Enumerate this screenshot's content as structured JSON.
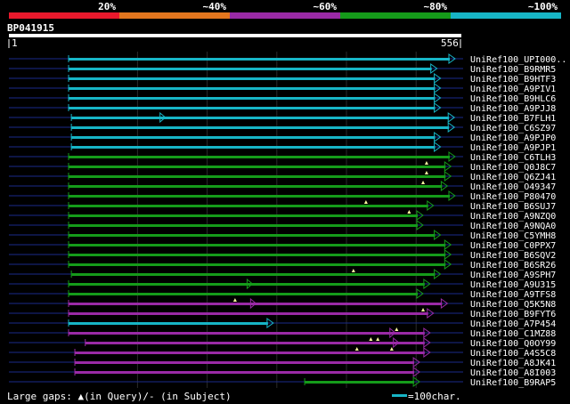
{
  "query_id": "BP041915",
  "length_start": "1",
  "length_end": "556",
  "identity_scale": [
    {
      "label": "20%",
      "color": "#e8192c"
    },
    {
      "label": "~40%",
      "color": "#e3761e"
    },
    {
      "label": "~60%",
      "color": "#9a2aa6"
    },
    {
      "label": "~80%",
      "color": "#159b1a"
    },
    {
      "label": "~100%",
      "color": "#17b5c6"
    }
  ],
  "footer": {
    "gaps_text": "Large gaps: ▲(in Query)/- (in Subject)",
    "scale_text": "=100char."
  },
  "chart_data": {
    "type": "alignment",
    "query_length": 556,
    "hits": [
      {
        "name": "UniRef100_UPI000..",
        "identity": "~100%",
        "start": 1,
        "end": 556,
        "markers": [],
        "sub_start": null
      },
      {
        "name": "UniRef100_B9RMR5",
        "identity": "~100%",
        "start": 1,
        "end": 530,
        "markers": [],
        "sub_start": null
      },
      {
        "name": "UniRef100_B9HTF3",
        "identity": "~100%",
        "start": 1,
        "end": 535,
        "markers": [],
        "sub_start": null
      },
      {
        "name": "UniRef100_A9PIV1",
        "identity": "~100%",
        "start": 1,
        "end": 535,
        "markers": [],
        "sub_start": null
      },
      {
        "name": "UniRef100_B9HLC6",
        "identity": "~100%",
        "start": 1,
        "end": 535,
        "markers": [],
        "sub_start": null
      },
      {
        "name": "UniRef100_A9PJJ8",
        "identity": "~100%",
        "start": 1,
        "end": 535,
        "markers": [],
        "sub_start": null
      },
      {
        "name": "UniRef100_B7FLH1",
        "identity": "~100%",
        "start": 5,
        "end": 555,
        "markers": [],
        "sub_start": 140
      },
      {
        "name": "UniRef100_C6SZ97",
        "identity": "~100%",
        "start": 5,
        "end": 555,
        "markers": [],
        "sub_start": null
      },
      {
        "name": "UniRef100_A9PJP0",
        "identity": "~100%",
        "start": 5,
        "end": 535,
        "markers": [],
        "sub_start": null
      },
      {
        "name": "UniRef100_A9PJP1",
        "identity": "~100%",
        "start": 5,
        "end": 535,
        "markers": [],
        "sub_start": null
      },
      {
        "name": "UniRef100_C6TLH3",
        "identity": "~80%",
        "start": 1,
        "end": 556,
        "markers": [],
        "sub_start": null
      },
      {
        "name": "UniRef100_Q0J8C7",
        "identity": "~80%",
        "start": 1,
        "end": 550,
        "markers": [
          515
        ],
        "sub_start": null
      },
      {
        "name": "UniRef100_Q6ZJ41",
        "identity": "~80%",
        "start": 1,
        "end": 550,
        "markers": [
          515
        ],
        "sub_start": null
      },
      {
        "name": "UniRef100_O49347",
        "identity": "~80%",
        "start": 1,
        "end": 545,
        "markers": [
          510
        ],
        "sub_start": null
      },
      {
        "name": "UniRef100_P80470",
        "identity": "~80%",
        "start": 1,
        "end": 556,
        "markers": [],
        "sub_start": null
      },
      {
        "name": "UniRef100_B6SUJ7",
        "identity": "~80%",
        "start": 1,
        "end": 525,
        "markers": [
          428
        ],
        "sub_start": null
      },
      {
        "name": "UniRef100_A9NZQ0",
        "identity": "~80%",
        "start": 1,
        "end": 510,
        "markers": [
          490
        ],
        "sub_start": null
      },
      {
        "name": "UniRef100_A9NQA0",
        "identity": "~80%",
        "start": 1,
        "end": 510,
        "markers": [],
        "sub_start": null
      },
      {
        "name": "UniRef100_C5YMH8",
        "identity": "~80%",
        "start": 1,
        "end": 535,
        "markers": [],
        "sub_start": null
      },
      {
        "name": "UniRef100_C0PPX7",
        "identity": "~80%",
        "start": 1,
        "end": 550,
        "markers": [],
        "sub_start": null
      },
      {
        "name": "UniRef100_B6SQV2",
        "identity": "~80%",
        "start": 1,
        "end": 550,
        "markers": [],
        "sub_start": null
      },
      {
        "name": "UniRef100_B6SR26",
        "identity": "~80%",
        "start": 1,
        "end": 550,
        "markers": [],
        "sub_start": null
      },
      {
        "name": "UniRef100_A9SPH7",
        "identity": "~80%",
        "start": 5,
        "end": 535,
        "markers": [
          410
        ],
        "sub_start": null
      },
      {
        "name": "UniRef100_A9U315",
        "identity": "~80%",
        "start": 1,
        "end": 520,
        "markers": [],
        "sub_start": 265
      },
      {
        "name": "UniRef100_A9TFS8",
        "identity": "~80%",
        "start": 1,
        "end": 510,
        "markers": [],
        "sub_start": null
      },
      {
        "name": "UniRef100_Q5K5N8",
        "identity": "~60%",
        "start": 1,
        "end": 545,
        "markers": [
          240
        ],
        "sub_start": 270
      },
      {
        "name": "UniRef100_B9FYT6",
        "identity": "~60%",
        "start": 1,
        "end": 525,
        "markers": [
          510
        ],
        "sub_start": null
      },
      {
        "name": "UniRef100_A7P454",
        "identity": "~100%",
        "start": 1,
        "end": 295,
        "markers": [],
        "sub_start": null
      },
      {
        "name": "UniRef100_C1MZ88",
        "identity": "~60%",
        "start": 1,
        "end": 520,
        "markers": [
          472
        ],
        "sub_start": 470
      },
      {
        "name": "UniRef100_Q0OY99",
        "identity": "~60%",
        "start": 25,
        "end": 520,
        "markers": [
          435,
          445
        ],
        "sub_start": 475
      },
      {
        "name": "UniRef100_A4S5C8",
        "identity": "~60%",
        "start": 10,
        "end": 520,
        "markers": [
          415,
          465
        ],
        "sub_start": null
      },
      {
        "name": "UniRef100_A8JK41",
        "identity": "~60%",
        "start": 10,
        "end": 505,
        "markers": [],
        "sub_start": null
      },
      {
        "name": "UniRef100_A8I003",
        "identity": "~60%",
        "start": 10,
        "end": 505,
        "markers": [],
        "sub_start": null
      },
      {
        "name": "UniRef100_B9RAP5",
        "identity": "~80%",
        "start": 340,
        "end": 505,
        "markers": [],
        "sub_start": null
      }
    ]
  }
}
